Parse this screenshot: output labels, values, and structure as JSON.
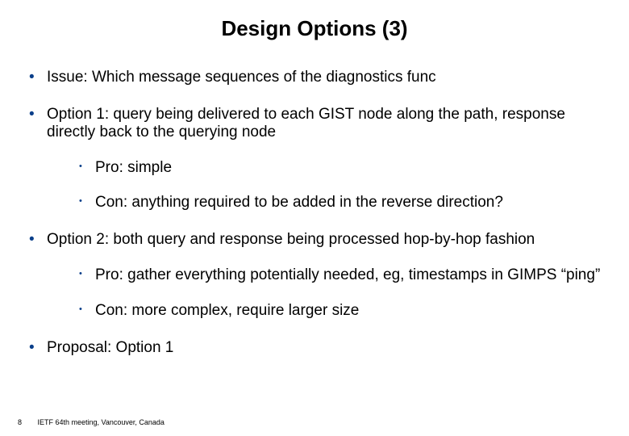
{
  "title": "Design Options (3)",
  "bullets": {
    "issue": "Issue: Which message sequences of the diagnostics func",
    "option1": "Option 1: query being delivered to each GIST node along the path, response directly back to the querying node",
    "option1_pro": "Pro: simple",
    "option1_con": "Con: anything required to be added in the reverse direction?",
    "option2": "Option 2: both query and response being processed hop-by-hop fashion",
    "option2_pro": "Pro: gather everything potentially needed, eg, timestamps in GIMPS “ping”",
    "option2_con": "Con: more complex, require larger size",
    "proposal": "Proposal: Option 1"
  },
  "footer": {
    "page": "8",
    "text": "IETF 64th meeting, Vancouver, Canada"
  }
}
